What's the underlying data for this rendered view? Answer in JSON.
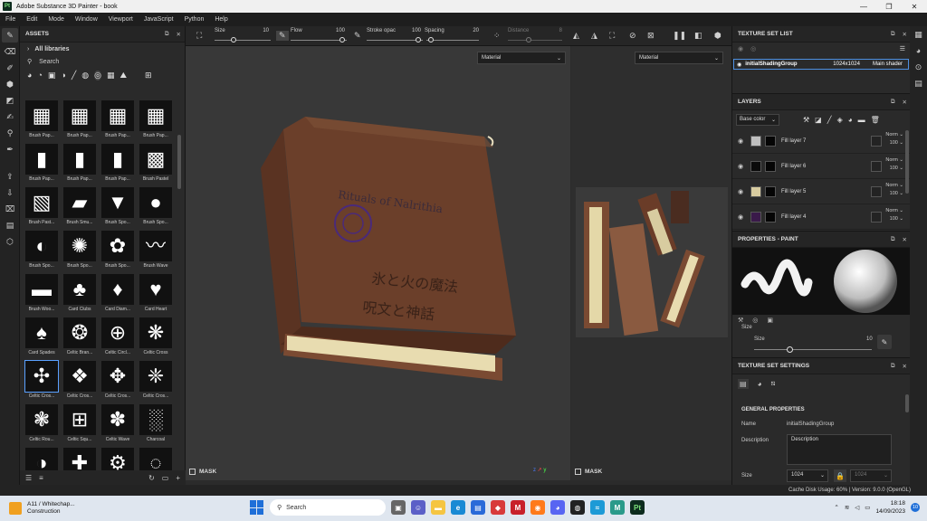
{
  "window": {
    "title": "Adobe Substance 3D Painter - book",
    "logo": "Pt"
  },
  "menu": [
    "File",
    "Edit",
    "Mode",
    "Window",
    "Viewport",
    "JavaScript",
    "Python",
    "Help"
  ],
  "assets": {
    "title": "ASSETS",
    "library": "All libraries",
    "search_placeholder": "Search",
    "items": [
      {
        "label": "Brush Pap...",
        "glyph": "▦"
      },
      {
        "label": "Brush Pap...",
        "glyph": "▦"
      },
      {
        "label": "Brush Pap...",
        "glyph": "▦"
      },
      {
        "label": "Brush Pap...",
        "glyph": "▦"
      },
      {
        "label": "Brush Pap...",
        "glyph": "▮"
      },
      {
        "label": "Brush Pap...",
        "glyph": "▮"
      },
      {
        "label": "Brush Pap...",
        "glyph": "▮"
      },
      {
        "label": "Brush Pastel",
        "glyph": "▩"
      },
      {
        "label": "Brush Past...",
        "glyph": "▧"
      },
      {
        "label": "Brush Smu...",
        "glyph": "▰"
      },
      {
        "label": "Brush Spo...",
        "glyph": "▼"
      },
      {
        "label": "Brush Spo...",
        "glyph": "●"
      },
      {
        "label": "Brush Spo...",
        "glyph": "◐"
      },
      {
        "label": "Brush Spo...",
        "glyph": "✺"
      },
      {
        "label": "Brush Spo...",
        "glyph": "✿"
      },
      {
        "label": "Brush Wave",
        "glyph": "〰"
      },
      {
        "label": "Brush Woo...",
        "glyph": "▬"
      },
      {
        "label": "Card Clubs",
        "glyph": "♣"
      },
      {
        "label": "Card Diam...",
        "glyph": "♦"
      },
      {
        "label": "Card Heart",
        "glyph": "♥"
      },
      {
        "label": "Card Spades",
        "glyph": "♠"
      },
      {
        "label": "Celtic Bran...",
        "glyph": "❂"
      },
      {
        "label": "Celtic Circl...",
        "glyph": "⊕"
      },
      {
        "label": "Celtic Cross",
        "glyph": "❋"
      },
      {
        "label": "Celtic Cros...",
        "glyph": "✣"
      },
      {
        "label": "Celtic Cros...",
        "glyph": "❖"
      },
      {
        "label": "Celtic Cros...",
        "glyph": "✥"
      },
      {
        "label": "Celtic Cros...",
        "glyph": "❈"
      },
      {
        "label": "Celtic Rou...",
        "glyph": "❃"
      },
      {
        "label": "Celtic Squ...",
        "glyph": "⊞"
      },
      {
        "label": "Celtic Wave",
        "glyph": "✽"
      },
      {
        "label": "Charcoal",
        "glyph": "░"
      },
      {
        "label": "Checker Ci...",
        "glyph": "◑"
      },
      {
        "label": "Circle Bran...",
        "glyph": "✚"
      },
      {
        "label": "Circle Cog",
        "glyph": "⚙"
      },
      {
        "label": "Circle Cros...",
        "glyph": "◌"
      },
      {
        "label": "",
        "glyph": "●"
      },
      {
        "label": "",
        "glyph": "•••"
      },
      {
        "label": "",
        "glyph": "◯"
      },
      {
        "label": "",
        "glyph": "◯"
      }
    ],
    "selected_index": 24
  },
  "toolbar": {
    "size_label": "Size",
    "size_value": "10",
    "flow_label": "Flow",
    "flow_value": "100",
    "stroke_label": "Stroke opac",
    "stroke_value": "100",
    "spacing_label": "Spacing",
    "spacing_value": "20",
    "distance_label": "Distance",
    "distance_value": "8"
  },
  "viewport3d": {
    "material": "Material",
    "mask": "MASK"
  },
  "viewport2d": {
    "material": "Material",
    "mask": "MASK"
  },
  "book": {
    "title_en": "Rituals of Nalrithia",
    "title_jp_line1": "氷と火の魔法",
    "title_jp_line2": "呪文と神話",
    "cover_color": "#6b3f2a",
    "pages_color": "#e8dcb0"
  },
  "texture_set_list": {
    "title": "TEXTURE SET LIST",
    "row": {
      "name": "initialShadingGroup",
      "resolution": "1024x1024",
      "shader": "Main shader"
    }
  },
  "layers": {
    "title": "LAYERS",
    "channel": "Base color",
    "items": [
      {
        "name": "Fill layer 7",
        "swatch": "#bfbfbf",
        "blend": "Norm",
        "opacity": "100"
      },
      {
        "name": "Fill layer 6",
        "swatch": "#0a0a0a",
        "blend": "Norm",
        "opacity": "100"
      },
      {
        "name": "Fill layer 5",
        "swatch": "#d8cca0",
        "blend": "Norm",
        "opacity": "100"
      },
      {
        "name": "Fill layer 4",
        "swatch": "#3a1a4a",
        "blend": "Norm",
        "opacity": "100"
      }
    ]
  },
  "properties_paint": {
    "title": "PROPERTIES - PAINT",
    "size_section": "Size",
    "size_label": "Size",
    "size_value": "10"
  },
  "texture_set_settings": {
    "title": "TEXTURE SET SETTINGS",
    "section": "GENERAL PROPERTIES",
    "name_label": "Name",
    "name_value": "initialShadingGroup",
    "desc_label": "Description",
    "desc_value": "Description",
    "size_label": "Size",
    "size_value": "1024",
    "size_value2": "1024"
  },
  "status": {
    "text": "Cache Disk Usage:  60% | Version: 9.0.0 (OpenGL)"
  },
  "taskbar": {
    "weather_title": "A11 / Whitechap...",
    "weather_sub": "Construction",
    "search_placeholder": "Search",
    "time": "18:18",
    "date": "14/09/2023",
    "notif_count": "10",
    "chat_badge": "1"
  }
}
